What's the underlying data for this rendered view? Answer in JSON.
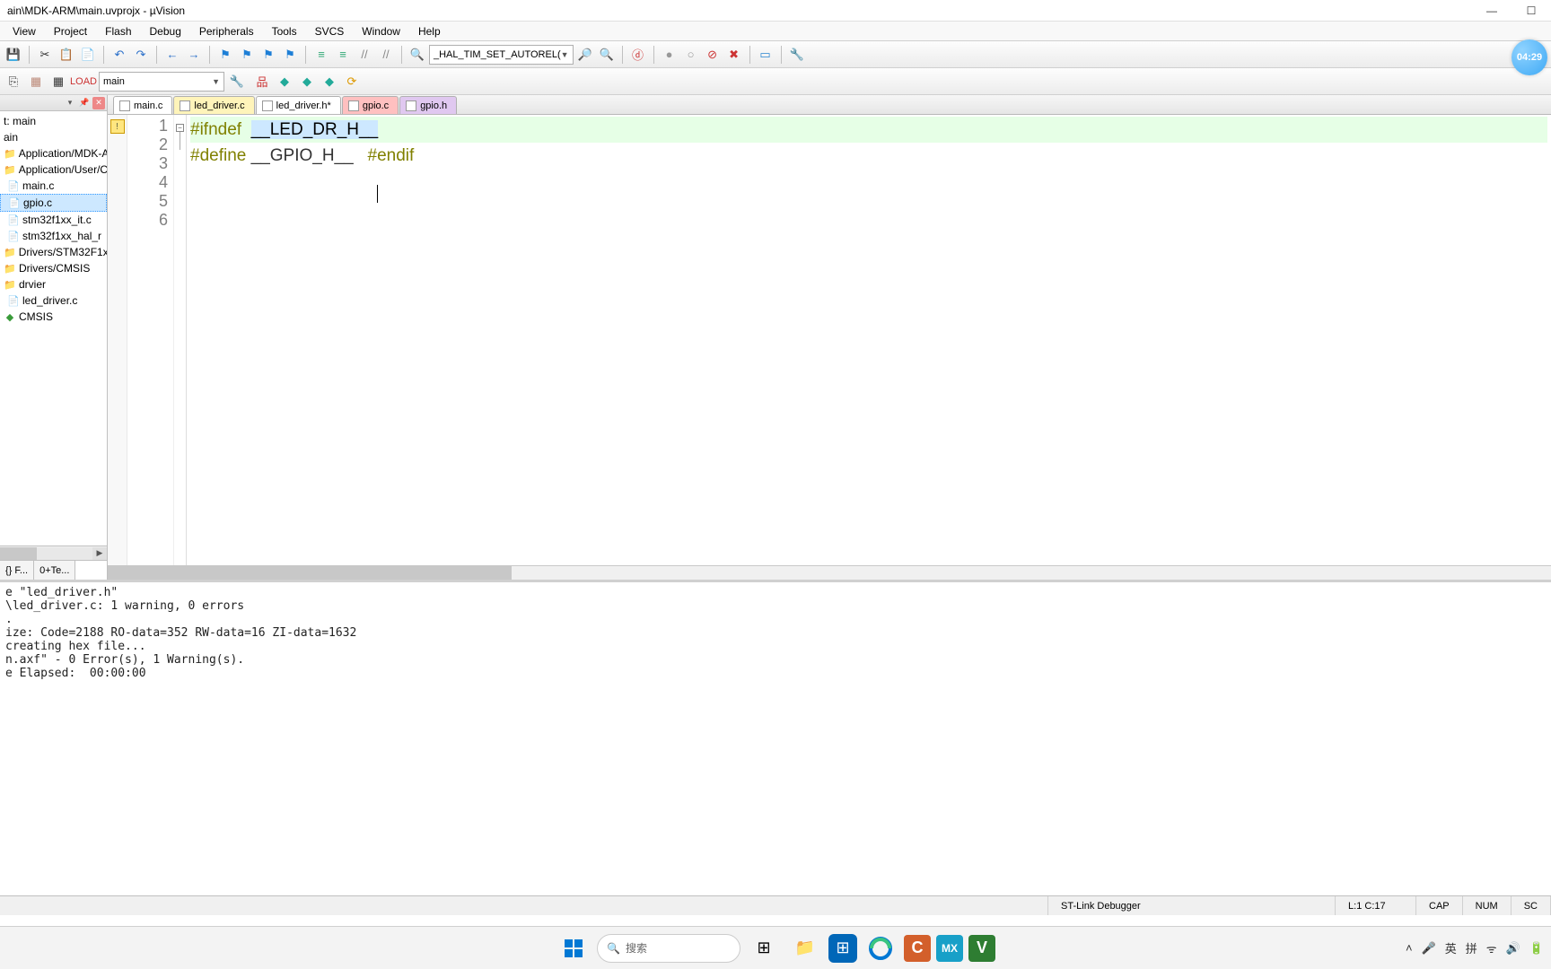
{
  "titlebar": {
    "title": "ain\\MDK-ARM\\main.uvprojx - µVision"
  },
  "menu": {
    "items": [
      "View",
      "Project",
      "Flash",
      "Debug",
      "Peripherals",
      "Tools",
      "SVCS",
      "Window",
      "Help"
    ]
  },
  "toolbar1": {
    "combo": "_HAL_TIM_SET_AUTOREL("
  },
  "toolbar2": {
    "target": "main"
  },
  "clock": {
    "time": "04:29"
  },
  "sidebar": {
    "root": "t: main",
    "target": "ain",
    "groups": [
      "Application/MDK-A",
      "Application/User/C"
    ],
    "files_user": [
      "main.c",
      "gpio.c",
      "stm32f1xx_it.c",
      "stm32f1xx_hal_r"
    ],
    "group_drivers": "Drivers/STM32F1xx_",
    "group_cmsis1": "Drivers/CMSIS",
    "group_drvier": "drvier",
    "file_led": "led_driver.c",
    "group_cmsis2": "CMSIS",
    "bottom_tabs": [
      "{} F...",
      "0+Te..."
    ]
  },
  "editor": {
    "tabs": [
      {
        "label": "main.c",
        "style": "white"
      },
      {
        "label": "led_driver.c",
        "style": "yellow"
      },
      {
        "label": "led_driver.h*",
        "style": "active"
      },
      {
        "label": "gpio.c",
        "style": "red"
      },
      {
        "label": "gpio.h",
        "style": "purple"
      }
    ],
    "lines": [
      "1",
      "2",
      "3",
      "4",
      "5",
      "6"
    ],
    "code": {
      "l1_kw": "#ifndef",
      "l1_pad": "  ",
      "l1_sel": "__LED_DR_H__",
      "l2_kw": "#define",
      "l2_rest": " __GPIO_H__",
      "l4_kw": "#endif"
    }
  },
  "output": {
    "text": "e \"led_driver.h\"\n\\led_driver.c: 1 warning, 0 errors\n.\nize: Code=2188 RO-data=352 RW-data=16 ZI-data=1632\ncreating hex file...\nn.axf\" - 0 Error(s), 1 Warning(s).\ne Elapsed:  00:00:00"
  },
  "statusbar": {
    "debugger": "ST-Link Debugger",
    "pos": "L:1 C:17",
    "caps": "CAP",
    "num": "NUM",
    "scr": "SC"
  },
  "taskbar": {
    "search": "搜索",
    "ime1": "英",
    "ime2": "拼",
    "tray_icons": [
      "ᯤ",
      "🔊",
      "🔋"
    ]
  }
}
